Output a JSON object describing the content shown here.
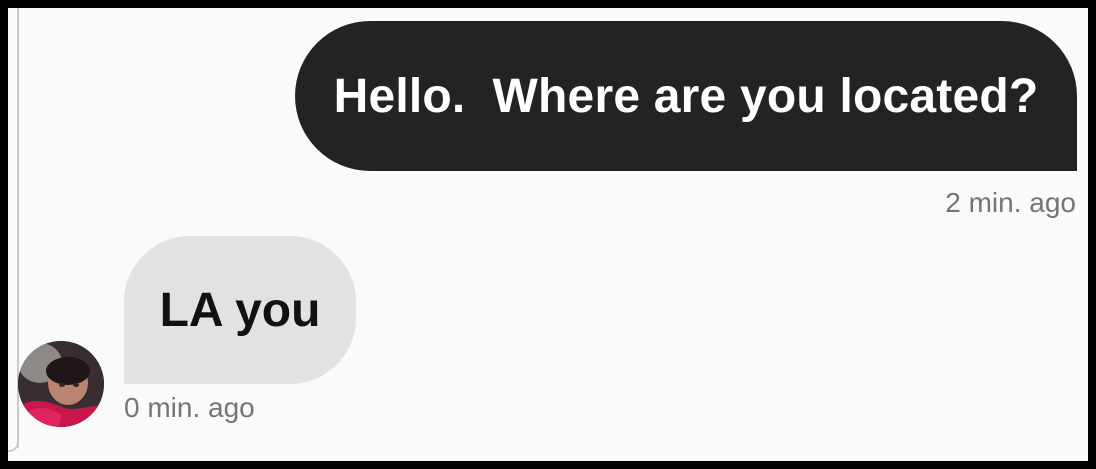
{
  "conversation": {
    "messages": [
      {
        "direction": "outgoing",
        "text": "Hello.  Where are you located?",
        "time": "2 min. ago"
      },
      {
        "direction": "incoming",
        "text": "LA you",
        "time": "0 min. ago"
      }
    ]
  },
  "colors": {
    "outgoing_bubble": "#232323",
    "incoming_bubble": "#e2e2e2",
    "timestamp_text": "#757575",
    "background": "#fafafa"
  },
  "icons": {
    "contact_avatar": "contact-avatar-photo"
  }
}
